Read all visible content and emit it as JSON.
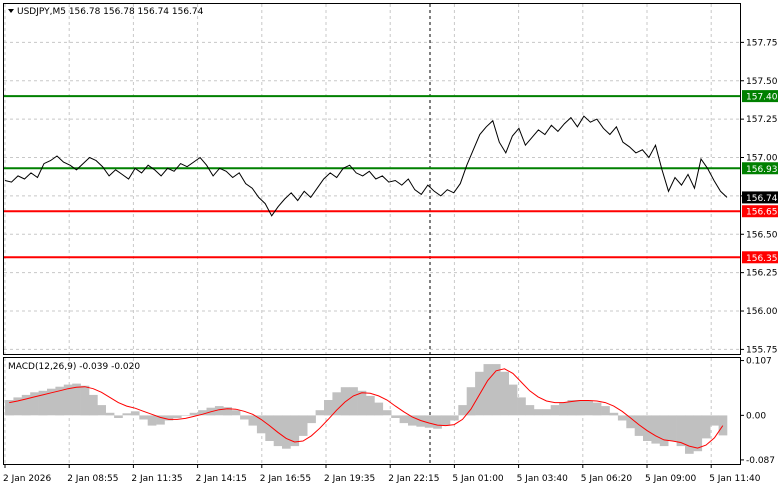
{
  "chart_data": [
    {
      "type": "line",
      "title": "USDJPY,M5  156.78 156.78 156.74 156.74",
      "symbol": "USDJPY,M5",
      "ohlc": [
        "156.78",
        "156.78",
        "156.74",
        "156.74"
      ],
      "ylim": [
        155.72,
        158.0
      ],
      "y_ticks": [
        "157.75",
        "157.50",
        "157.25",
        "157.00",
        "156.75",
        "156.50",
        "156.25",
        "156.00",
        "155.75"
      ],
      "x_ticks": [
        "2 Jan 2026",
        "2 Jan 08:55",
        "2 Jan 11:35",
        "2 Jan 14:15",
        "2 Jan 16:55",
        "2 Jan 19:35",
        "2 Jan 22:15",
        "5 Jan 01:00",
        "5 Jan 03:40",
        "5 Jan 06:20",
        "5 Jan 09:00",
        "5 Jan 11:40"
      ],
      "grid": true,
      "levels": [
        {
          "label": "157.40",
          "value": 157.4,
          "color": "#008000",
          "bg": "#008000"
        },
        {
          "label": "156.93",
          "value": 156.93,
          "color": "#008000",
          "bg": "#008000"
        },
        {
          "label": "156.74",
          "value": 156.74,
          "color": "#000000",
          "bg": "#000000",
          "line": false
        },
        {
          "label": "156.65",
          "value": 156.65,
          "color": "#ff0000",
          "bg": "#ff0000"
        },
        {
          "label": "156.35",
          "value": 156.35,
          "color": "#ff0000",
          "bg": "#ff0000"
        }
      ],
      "series": [
        {
          "values": [
            156.85,
            156.84,
            156.88,
            156.86,
            156.9,
            156.87,
            156.96,
            156.98,
            157.01,
            156.97,
            156.95,
            156.92,
            156.96,
            157.0,
            156.98,
            156.94,
            156.88,
            156.92,
            156.89,
            156.86,
            156.93,
            156.9,
            156.95,
            156.92,
            156.88,
            156.93,
            156.91,
            156.96,
            156.94,
            156.97,
            157.0,
            156.95,
            156.88,
            156.93,
            156.91,
            156.87,
            156.9,
            156.83,
            156.8,
            156.74,
            156.7,
            156.62,
            156.68,
            156.73,
            156.77,
            156.72,
            156.78,
            156.74,
            156.8,
            156.86,
            156.9,
            156.87,
            156.93,
            156.95,
            156.9,
            156.88,
            156.91,
            156.86,
            156.88,
            156.84,
            156.85,
            156.82,
            156.86,
            156.79,
            156.76,
            156.82,
            156.78,
            156.75,
            156.79,
            156.77,
            156.83,
            156.95,
            157.05,
            157.15,
            157.2,
            157.24,
            157.1,
            157.03,
            157.14,
            157.19,
            157.08,
            157.13,
            157.18,
            157.15,
            157.21,
            157.17,
            157.22,
            157.26,
            157.2,
            157.27,
            157.23,
            157.25,
            157.19,
            157.15,
            157.2,
            157.1,
            157.07,
            157.03,
            157.05,
            157.0,
            157.08,
            156.92,
            156.78,
            156.87,
            156.82,
            156.89,
            156.8,
            156.99,
            156.93,
            156.85,
            156.78,
            156.74
          ]
        }
      ]
    },
    {
      "type": "bar",
      "title": "MACD(12,26,9) -0.039 -0.020",
      "ylim": [
        -0.095,
        0.112
      ],
      "y_ticks": [
        "0.107",
        "0.00",
        "-0.087"
      ],
      "series": [
        {
          "name": "MACD",
          "values": [
            0.03,
            0.035,
            0.04,
            0.045,
            0.048,
            0.052,
            0.056,
            0.06,
            0.062,
            0.058,
            0.04,
            0.02,
            0.005,
            -0.005,
            0.004,
            0.008,
            -0.008,
            -0.02,
            -0.018,
            -0.01,
            -0.005,
            0.0,
            0.005,
            0.01,
            0.015,
            0.018,
            0.016,
            0.01,
            -0.008,
            -0.02,
            -0.035,
            -0.05,
            -0.06,
            -0.065,
            -0.06,
            -0.04,
            -0.015,
            0.01,
            0.03,
            0.045,
            0.055,
            0.055,
            0.048,
            0.038,
            0.025,
            0.01,
            -0.005,
            -0.015,
            -0.02,
            -0.022,
            -0.024,
            -0.026,
            -0.02,
            -0.01,
            0.02,
            0.055,
            0.085,
            0.1,
            0.1,
            0.085,
            0.06,
            0.035,
            0.02,
            0.012,
            0.012,
            0.02,
            0.025,
            0.03,
            0.03,
            0.028,
            0.025,
            0.018,
            0.005,
            -0.01,
            -0.025,
            -0.04,
            -0.05,
            -0.055,
            -0.06,
            -0.05,
            -0.06,
            -0.075,
            -0.07,
            -0.045,
            -0.02,
            -0.039
          ]
        },
        {
          "name": "Signal",
          "values": [
            0.025,
            0.028,
            0.032,
            0.036,
            0.04,
            0.044,
            0.048,
            0.052,
            0.055,
            0.056,
            0.052,
            0.045,
            0.035,
            0.025,
            0.018,
            0.014,
            0.008,
            0.002,
            -0.004,
            -0.008,
            -0.008,
            -0.006,
            -0.002,
            0.002,
            0.007,
            0.011,
            0.013,
            0.012,
            0.008,
            0.002,
            -0.008,
            -0.02,
            -0.033,
            -0.045,
            -0.052,
            -0.05,
            -0.04,
            -0.025,
            -0.008,
            0.01,
            0.026,
            0.038,
            0.044,
            0.043,
            0.038,
            0.03,
            0.018,
            0.007,
            -0.003,
            -0.01,
            -0.015,
            -0.019,
            -0.02,
            -0.018,
            -0.008,
            0.012,
            0.04,
            0.068,
            0.087,
            0.091,
            0.082,
            0.065,
            0.048,
            0.036,
            0.028,
            0.025,
            0.025,
            0.027,
            0.029,
            0.029,
            0.028,
            0.025,
            0.018,
            0.008,
            -0.005,
            -0.018,
            -0.03,
            -0.04,
            -0.048,
            -0.05,
            -0.053,
            -0.06,
            -0.064,
            -0.058,
            -0.044,
            -0.02
          ]
        }
      ]
    }
  ],
  "colors": {
    "price_line": "#000000",
    "histogram": "#c0c0c0",
    "signal_line": "#ff0000",
    "grid": "#c8c8c8",
    "vline": "#000000"
  }
}
